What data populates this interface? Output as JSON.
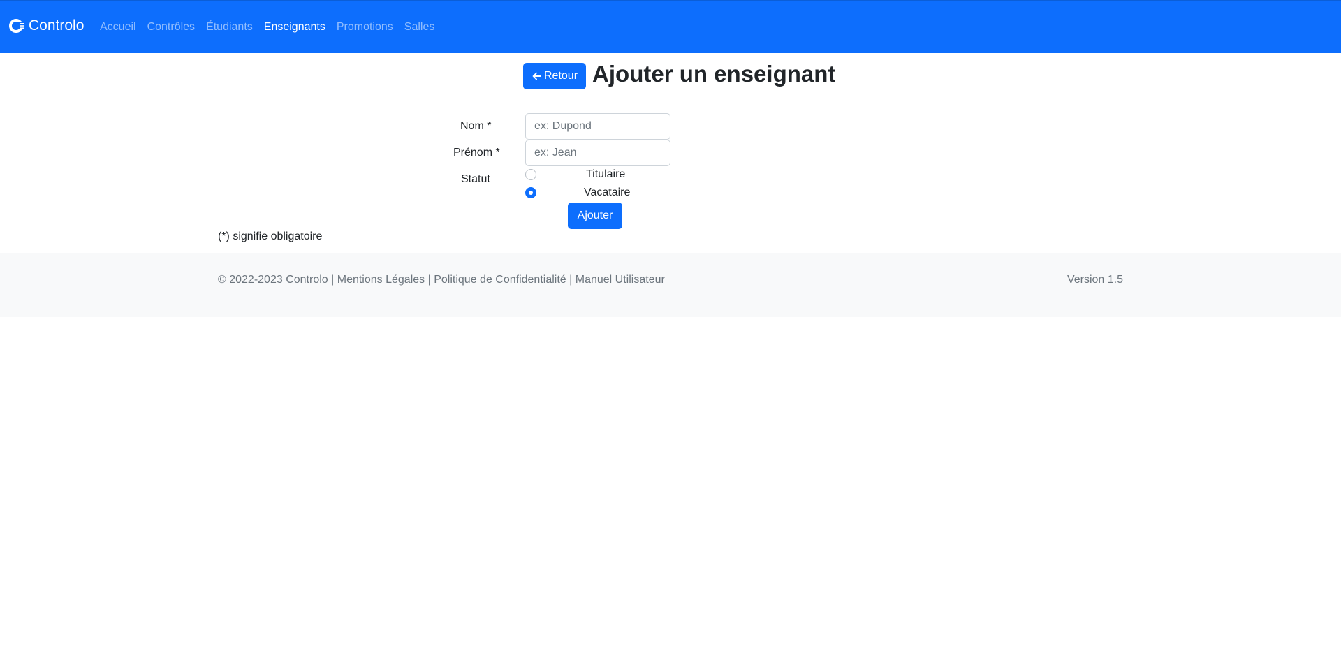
{
  "navbar": {
    "brand": "Controlo",
    "links": [
      {
        "label": "Accueil",
        "active": false
      },
      {
        "label": "Contrôles",
        "active": false
      },
      {
        "label": "Étudiants",
        "active": false
      },
      {
        "label": "Enseignants",
        "active": true
      },
      {
        "label": "Promotions",
        "active": false
      },
      {
        "label": "Salles",
        "active": false
      }
    ]
  },
  "header": {
    "back_label": "Retour",
    "title": "Ajouter un enseignant"
  },
  "form": {
    "nom_label": "Nom *",
    "nom_placeholder": "ex: Dupond",
    "prenom_label": "Prénom *",
    "prenom_placeholder": "ex: Jean",
    "statut_label": "Statut",
    "statut_options": [
      {
        "label": "Titulaire",
        "checked": false
      },
      {
        "label": "Vacataire",
        "checked": true
      }
    ],
    "submit_label": "Ajouter",
    "required_note": "(*) signifie obligatoire"
  },
  "footer": {
    "copyright": "© 2022-2023 Controlo |",
    "sep": "|",
    "links": [
      "Mentions Légales",
      "Politique de Confidentialité",
      "Manuel Utilisateur"
    ],
    "version": "Version 1.5"
  },
  "colors": {
    "primary": "#0d6efd",
    "footer_bg": "#f8f9fa"
  }
}
